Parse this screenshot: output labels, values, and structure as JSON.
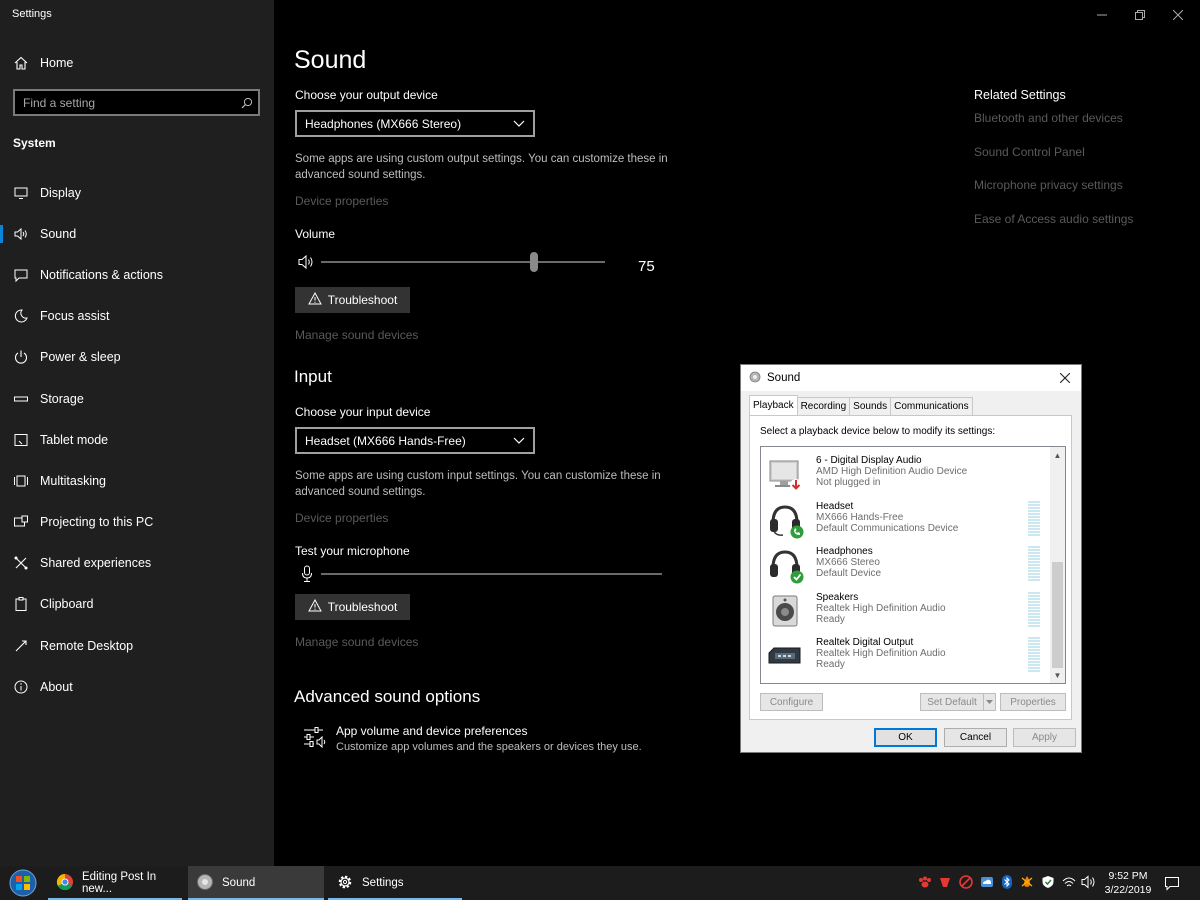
{
  "app": {
    "title": "Settings"
  },
  "sidebar": {
    "home_label": "Home",
    "search_placeholder": "Find a setting",
    "section_label": "System",
    "items": [
      {
        "label": "Display",
        "icon": "monitor-icon"
      },
      {
        "label": "Sound",
        "icon": "speaker-icon",
        "active": true
      },
      {
        "label": "Notifications & actions",
        "icon": "message-icon"
      },
      {
        "label": "Focus assist",
        "icon": "moon-icon"
      },
      {
        "label": "Power & sleep",
        "icon": "power-icon"
      },
      {
        "label": "Storage",
        "icon": "drive-icon"
      },
      {
        "label": "Tablet mode",
        "icon": "tablet-icon"
      },
      {
        "label": "Multitasking",
        "icon": "multitasking-icon"
      },
      {
        "label": "Projecting to this PC",
        "icon": "project-icon"
      },
      {
        "label": "Shared experiences",
        "icon": "shared-icon"
      },
      {
        "label": "Clipboard",
        "icon": "clipboard-icon"
      },
      {
        "label": "Remote Desktop",
        "icon": "remote-icon"
      },
      {
        "label": "About",
        "icon": "info-icon"
      }
    ]
  },
  "main": {
    "title": "Sound",
    "output": {
      "choose_label": "Choose your output device",
      "device": "Headphones (MX666 Stereo)",
      "custom_note": "Some apps are using custom output settings. You can customize these in advanced sound settings.",
      "properties_link": "Device properties",
      "volume_label": "Volume",
      "volume_value": "75",
      "volume_level": 0.75,
      "troubleshoot_label": "Troubleshoot",
      "manage_link": "Manage sound devices"
    },
    "input": {
      "heading": "Input",
      "choose_label": "Choose your input device",
      "device": "Headset (MX666 Hands-Free)",
      "custom_note": "Some apps are using custom input settings. You can customize these in advanced sound settings.",
      "properties_link": "Device properties",
      "test_label": "Test your microphone",
      "troubleshoot_label": "Troubleshoot",
      "manage_link": "Manage sound devices"
    },
    "advanced": {
      "heading": "Advanced sound options",
      "item_title": "App volume and device preferences",
      "item_desc": "Customize app volumes and the speakers or devices they use."
    }
  },
  "related": {
    "title": "Related Settings",
    "links": [
      "Bluetooth and other devices",
      "Sound Control Panel",
      "Microphone privacy settings",
      "Ease of Access audio settings"
    ]
  },
  "dialog": {
    "title": "Sound",
    "tabs": [
      "Playback",
      "Recording",
      "Sounds",
      "Communications"
    ],
    "active_tab": "Playback",
    "instruction": "Select a playback device below to modify its settings:",
    "devices": [
      {
        "name": "6 - Digital Display Audio",
        "line2": "AMD High Definition Audio Device",
        "line3": "Not plugged in",
        "icon": "monitor-device-icon",
        "badge": "unplugged"
      },
      {
        "name": "Headset",
        "line2": "MX666 Hands-Free",
        "line3": "Default Communications Device",
        "icon": "headset-device-icon",
        "badge": "communications"
      },
      {
        "name": "Headphones",
        "line2": "MX666 Stereo",
        "line3": "Default Device",
        "icon": "headphones-device-icon",
        "badge": "default"
      },
      {
        "name": "Speakers",
        "line2": "Realtek High Definition Audio",
        "line3": "Ready",
        "icon": "speaker-device-icon",
        "badge": ""
      },
      {
        "name": "Realtek Digital Output",
        "line2": "Realtek High Definition Audio",
        "line3": "Ready",
        "icon": "digital-output-icon",
        "badge": ""
      }
    ],
    "buttons": {
      "configure": "Configure",
      "set_default": "Set Default",
      "properties": "Properties",
      "ok": "OK",
      "cancel": "Cancel",
      "apply": "Apply"
    }
  },
  "taskbar": {
    "tasks": [
      {
        "label": "Editing Post In new...",
        "icon": "chrome-icon"
      },
      {
        "label": "Sound",
        "icon": "sound-app-icon",
        "active": true
      },
      {
        "label": "Settings",
        "icon": "settings-gear-icon"
      }
    ],
    "time": "9:52 PM",
    "date": "3/22/2019"
  },
  "colors": {
    "accent": "#0078d7",
    "sidebar_bg": "#1f1f1f",
    "main_bg": "#000000",
    "dim_text": "#5a5a5a"
  }
}
